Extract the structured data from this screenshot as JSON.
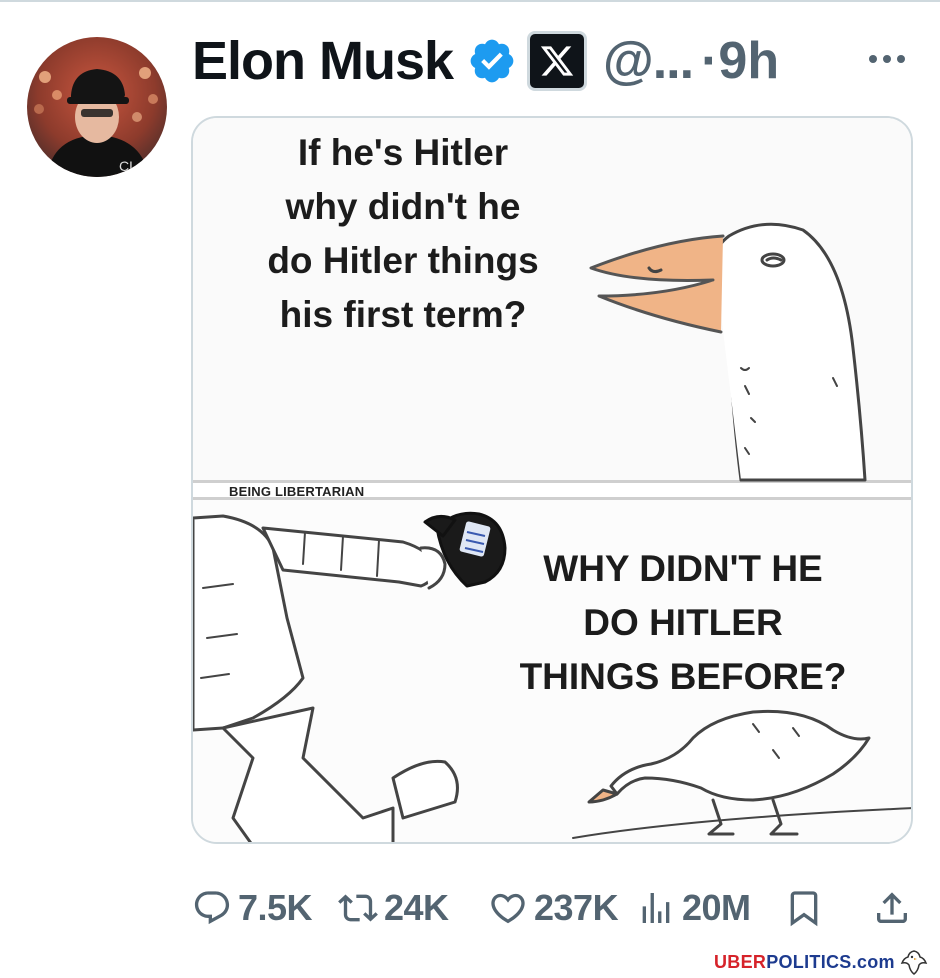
{
  "tweet": {
    "display_name": "Elon Musk",
    "handle": "@...",
    "separator": "·",
    "time": "9h",
    "icons": {
      "avatar": "profile-photo",
      "verified": "verified-badge-icon",
      "affiliate": "x-logo-icon",
      "more": "more-dots-icon"
    },
    "colors": {
      "verified": "#1d9bf0",
      "secondary_text": "#536471"
    }
  },
  "media": {
    "top_caption": [
      "If he's Hitler",
      "why didn't he",
      "do Hitler things",
      "his first term?"
    ],
    "watermark": "BEING LIBERTARIAN",
    "bottom_caption": [
      "WHY DIDN'T HE",
      "DO HITLER",
      "THINGS BEFORE?"
    ]
  },
  "actions": {
    "replies": "7.5K",
    "reposts": "24K",
    "likes": "237K",
    "views": "20M",
    "icons": [
      "reply-icon",
      "repost-icon",
      "like-icon",
      "views-icon",
      "bookmark-icon",
      "share-icon"
    ]
  },
  "footer": {
    "brand_part1": "UBER",
    "brand_part2": "POLITICS",
    "brand_part3": ".com",
    "colors": {
      "uber": "#d6232a",
      "politics": "#1d3b8f"
    }
  }
}
